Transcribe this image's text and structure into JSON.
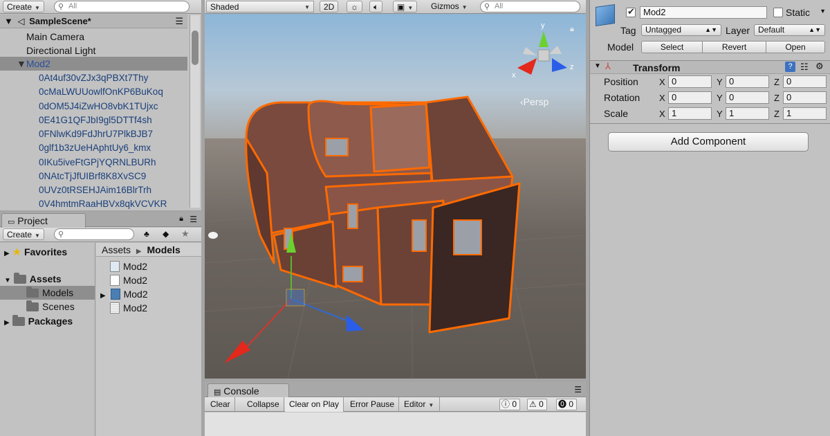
{
  "hierarchy": {
    "create_label": "Create",
    "search_placeholder": "All",
    "scene_name": "SampleScene*",
    "items": [
      {
        "label": "Main Camera"
      },
      {
        "label": "Directional Light"
      },
      {
        "label": "Mod2"
      }
    ],
    "children": [
      "0At4uf30vZJx3qPBXt7Thy",
      "0cMaLWUUowlfOnKP6BuKoq",
      "0dOM5J4iZwHO8vbK1TUjxc",
      "0E41G1QFJbI9gl5DTTf4sh",
      "0FNlwKd9FdJhrU7PlkBJB7",
      "0glf1b3zUeHAphtUy6_kmx",
      "0IKu5iveFtGPjYQRNLBURh",
      "0NAtcTjJfUIBrf8K8XvSC9",
      "0UVz0tRSEHJAim16BlrTrh",
      "0V4hmtmRaaHBVx8qkVCVKR"
    ]
  },
  "project": {
    "tab_label": "Project",
    "create_label": "Create",
    "search_placeholder": "",
    "tree": [
      "Favorites",
      "Assets",
      "Models",
      "Scenes",
      "Packages"
    ],
    "breadcrumb": {
      "root": "Assets",
      "arrow": "▶",
      "current": "Models"
    },
    "files": [
      "Mod2",
      "Mod2",
      "Mod2",
      "Mod2"
    ]
  },
  "scene": {
    "shading_mode": "Shaded",
    "mode_2d": "2D",
    "gizmos_label": "Gizmos",
    "search_placeholder": "All",
    "persp_label": "‹Persp",
    "gizmo_axes": {
      "x": "x",
      "y": "y",
      "z": "z"
    }
  },
  "console": {
    "tab_label": "Console",
    "buttons": [
      "Clear",
      "Collapse",
      "Clear on Play",
      "Error Pause",
      "Editor"
    ],
    "counts": {
      "info": "0",
      "warning": "0",
      "error": "0"
    }
  },
  "inspector": {
    "object_name": "Mod2",
    "static_label": "Static",
    "tag_label": "Tag",
    "tag_value": "Untagged",
    "layer_label": "Layer",
    "layer_value": "Default",
    "model_label": "Model",
    "model_buttons": [
      "Select",
      "Revert",
      "Open"
    ],
    "transform_title": "Transform",
    "position_label": "Position",
    "rotation_label": "Rotation",
    "scale_label": "Scale",
    "axis_x": "X",
    "axis_y": "Y",
    "axis_z": "Z",
    "position": [
      "0",
      "0",
      "0"
    ],
    "rotation": [
      "0",
      "0",
      "0"
    ],
    "scale": [
      "1",
      "1",
      "1"
    ],
    "add_component_label": "Add Component"
  },
  "colors": {
    "selection_outline": "#ff6a00",
    "model_body": "#7a4a3e",
    "panel_bg": "#c2c2c2"
  }
}
